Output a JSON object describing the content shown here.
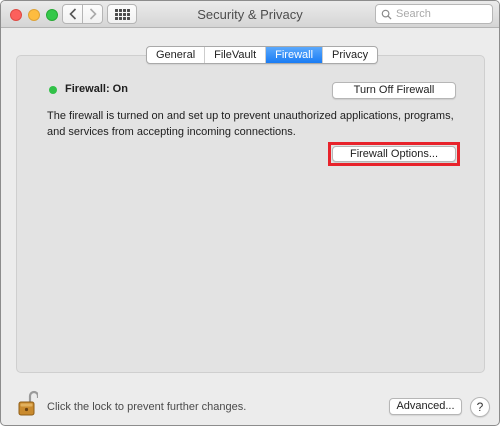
{
  "window": {
    "title": "Security & Privacy"
  },
  "toolbar": {
    "back_icon": "chevron-left-icon",
    "forward_icon": "chevron-right-icon",
    "grid_icon": "show-all-grid-icon"
  },
  "search": {
    "placeholder": "Search",
    "value": ""
  },
  "tabs": [
    {
      "label": "General",
      "active": false
    },
    {
      "label": "FileVault",
      "active": false
    },
    {
      "label": "Firewall",
      "active": true
    },
    {
      "label": "Privacy",
      "active": false
    }
  ],
  "firewall": {
    "status": "Firewall: On",
    "status_color": "#31c148",
    "turn_off_label": "Turn Off Firewall",
    "description": "The firewall is turned on and set up to prevent unauthorized applications, programs, and services from accepting incoming connections.",
    "options_label": "Firewall Options...",
    "highlight_color": "#e8232b"
  },
  "footer": {
    "lock_text": "Click the lock to prevent further changes.",
    "advanced_label": "Advanced...",
    "help_label": "?"
  },
  "colors": {
    "accent": "#1a7cf4",
    "close": "#fc605c",
    "minimize": "#fdbc40",
    "zoom": "#34c84a",
    "lock_gold": "#c98a2e"
  }
}
